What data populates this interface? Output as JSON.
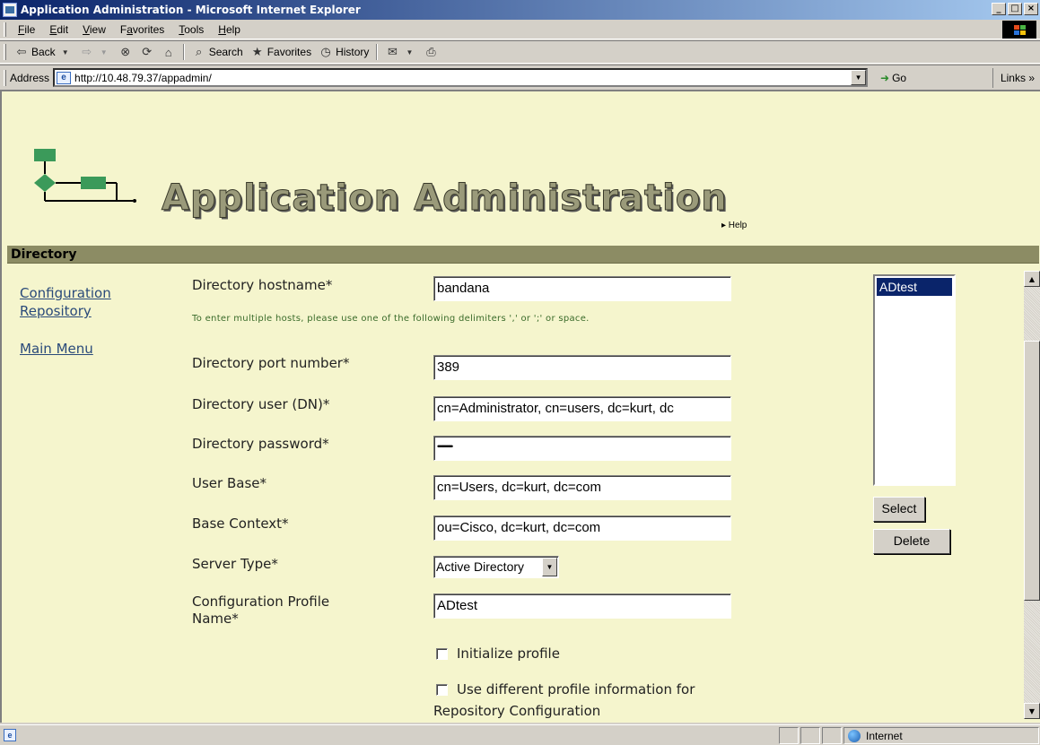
{
  "window": {
    "title": "Application Administration - Microsoft Internet Explorer",
    "min": "_",
    "max": "□",
    "close": "×"
  },
  "menu": {
    "items": [
      {
        "u": "F",
        "rest": "ile"
      },
      {
        "u": "E",
        "rest": "dit"
      },
      {
        "u": "V",
        "rest": "iew"
      },
      {
        "pre": "F",
        "u": "a",
        "rest": "vorites"
      },
      {
        "u": "T",
        "rest": "ools"
      },
      {
        "u": "H",
        "rest": "elp"
      }
    ]
  },
  "toolbar": {
    "back": "Back",
    "search": "Search",
    "favorites": "Favorites",
    "history": "History"
  },
  "address": {
    "label": "Address",
    "url": "http://10.48.79.37/appadmin/",
    "go": "Go",
    "links": "Links »"
  },
  "page": {
    "app_title": "Application Administration",
    "help": "▸ Help",
    "section": "Directory"
  },
  "nav": {
    "configuration": "Configuration",
    "repository": "Repository",
    "main_menu": "Main Menu"
  },
  "form": {
    "hostname_label": "Directory hostname*",
    "hostname_value": "bandana",
    "hint": "To enter multiple hosts, please use one of the following delimiters ',' or ';' or space.",
    "port_label": "Directory port number*",
    "port_value": "389",
    "user_label": "Directory user (DN)*",
    "user_value": "cn=Administrator, cn=users, dc=kurt, dc",
    "password_label": "Directory password*",
    "password_value": "••••••••••••••",
    "userbase_label": "User Base*",
    "userbase_value": "cn=Users, dc=kurt, dc=com",
    "basecontext_label": "Base Context*",
    "basecontext_value": "ou=Cisco, dc=kurt, dc=com",
    "servertype_label": "Server Type*",
    "servertype_value": "Active Directory",
    "profile_label_1": "Configuration Profile",
    "profile_label_2": "Name*",
    "profile_value": "ADtest",
    "init_profile": "Initialize profile",
    "diff_profile_1": "Use different profile information for",
    "diff_profile_2": "Repository Configuration"
  },
  "profiles": {
    "selected": "ADtest",
    "select_btn": "Select",
    "delete_btn": "Delete"
  },
  "status": {
    "zone": "Internet"
  }
}
